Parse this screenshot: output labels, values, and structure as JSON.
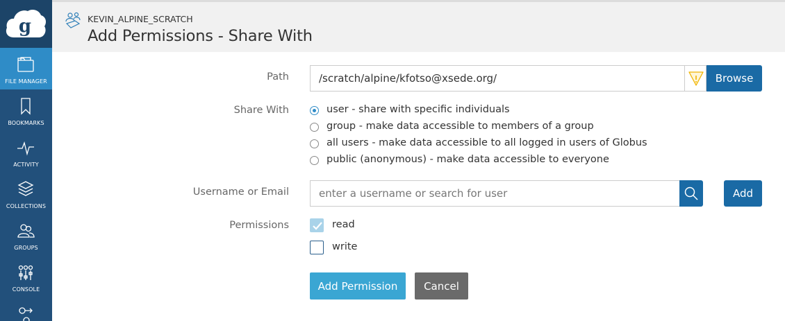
{
  "sidebar": {
    "items": [
      {
        "label": "FILE MANAGER",
        "icon": "folder-icon"
      },
      {
        "label": "BOOKMARKS",
        "icon": "bookmark-icon"
      },
      {
        "label": "ACTIVITY",
        "icon": "activity-icon"
      },
      {
        "label": "COLLECTIONS",
        "icon": "layers-icon"
      },
      {
        "label": "GROUPS",
        "icon": "groups-icon"
      },
      {
        "label": "CONSOLE",
        "icon": "sliders-icon"
      },
      {
        "label": "",
        "icon": "flows-icon"
      }
    ]
  },
  "header": {
    "collection_name": "KEVIN_ALPINE_SCRATCH",
    "title": "Add Permissions - Share With"
  },
  "form": {
    "path_label": "Path",
    "path_value": "/scratch/alpine/kfotso@xsede.org/",
    "browse_label": "Browse",
    "share_with_label": "Share With",
    "share_options": [
      {
        "text": "user - share with specific individuals",
        "checked": true
      },
      {
        "text": "group - make data accessible to members of a group",
        "checked": false
      },
      {
        "text": "all users - make data accessible to all logged in users of Globus",
        "checked": false
      },
      {
        "text": "public (anonymous) - make data accessible to everyone",
        "checked": false
      }
    ],
    "username_label": "Username or Email",
    "username_placeholder": "enter a username or search for user",
    "add_label": "Add",
    "permissions_label": "Permissions",
    "permissions": [
      {
        "text": "read",
        "checked": true
      },
      {
        "text": "write",
        "checked": false
      }
    ],
    "add_permission_label": "Add Permission",
    "cancel_label": "Cancel"
  },
  "colors": {
    "sidebar": "#22507b",
    "active": "#2f8cc7",
    "primary_button": "#1a6aa5",
    "add_permission_button": "#3aa6d3",
    "cancel_button": "#6a6a6a",
    "warning": "#f0b400"
  }
}
